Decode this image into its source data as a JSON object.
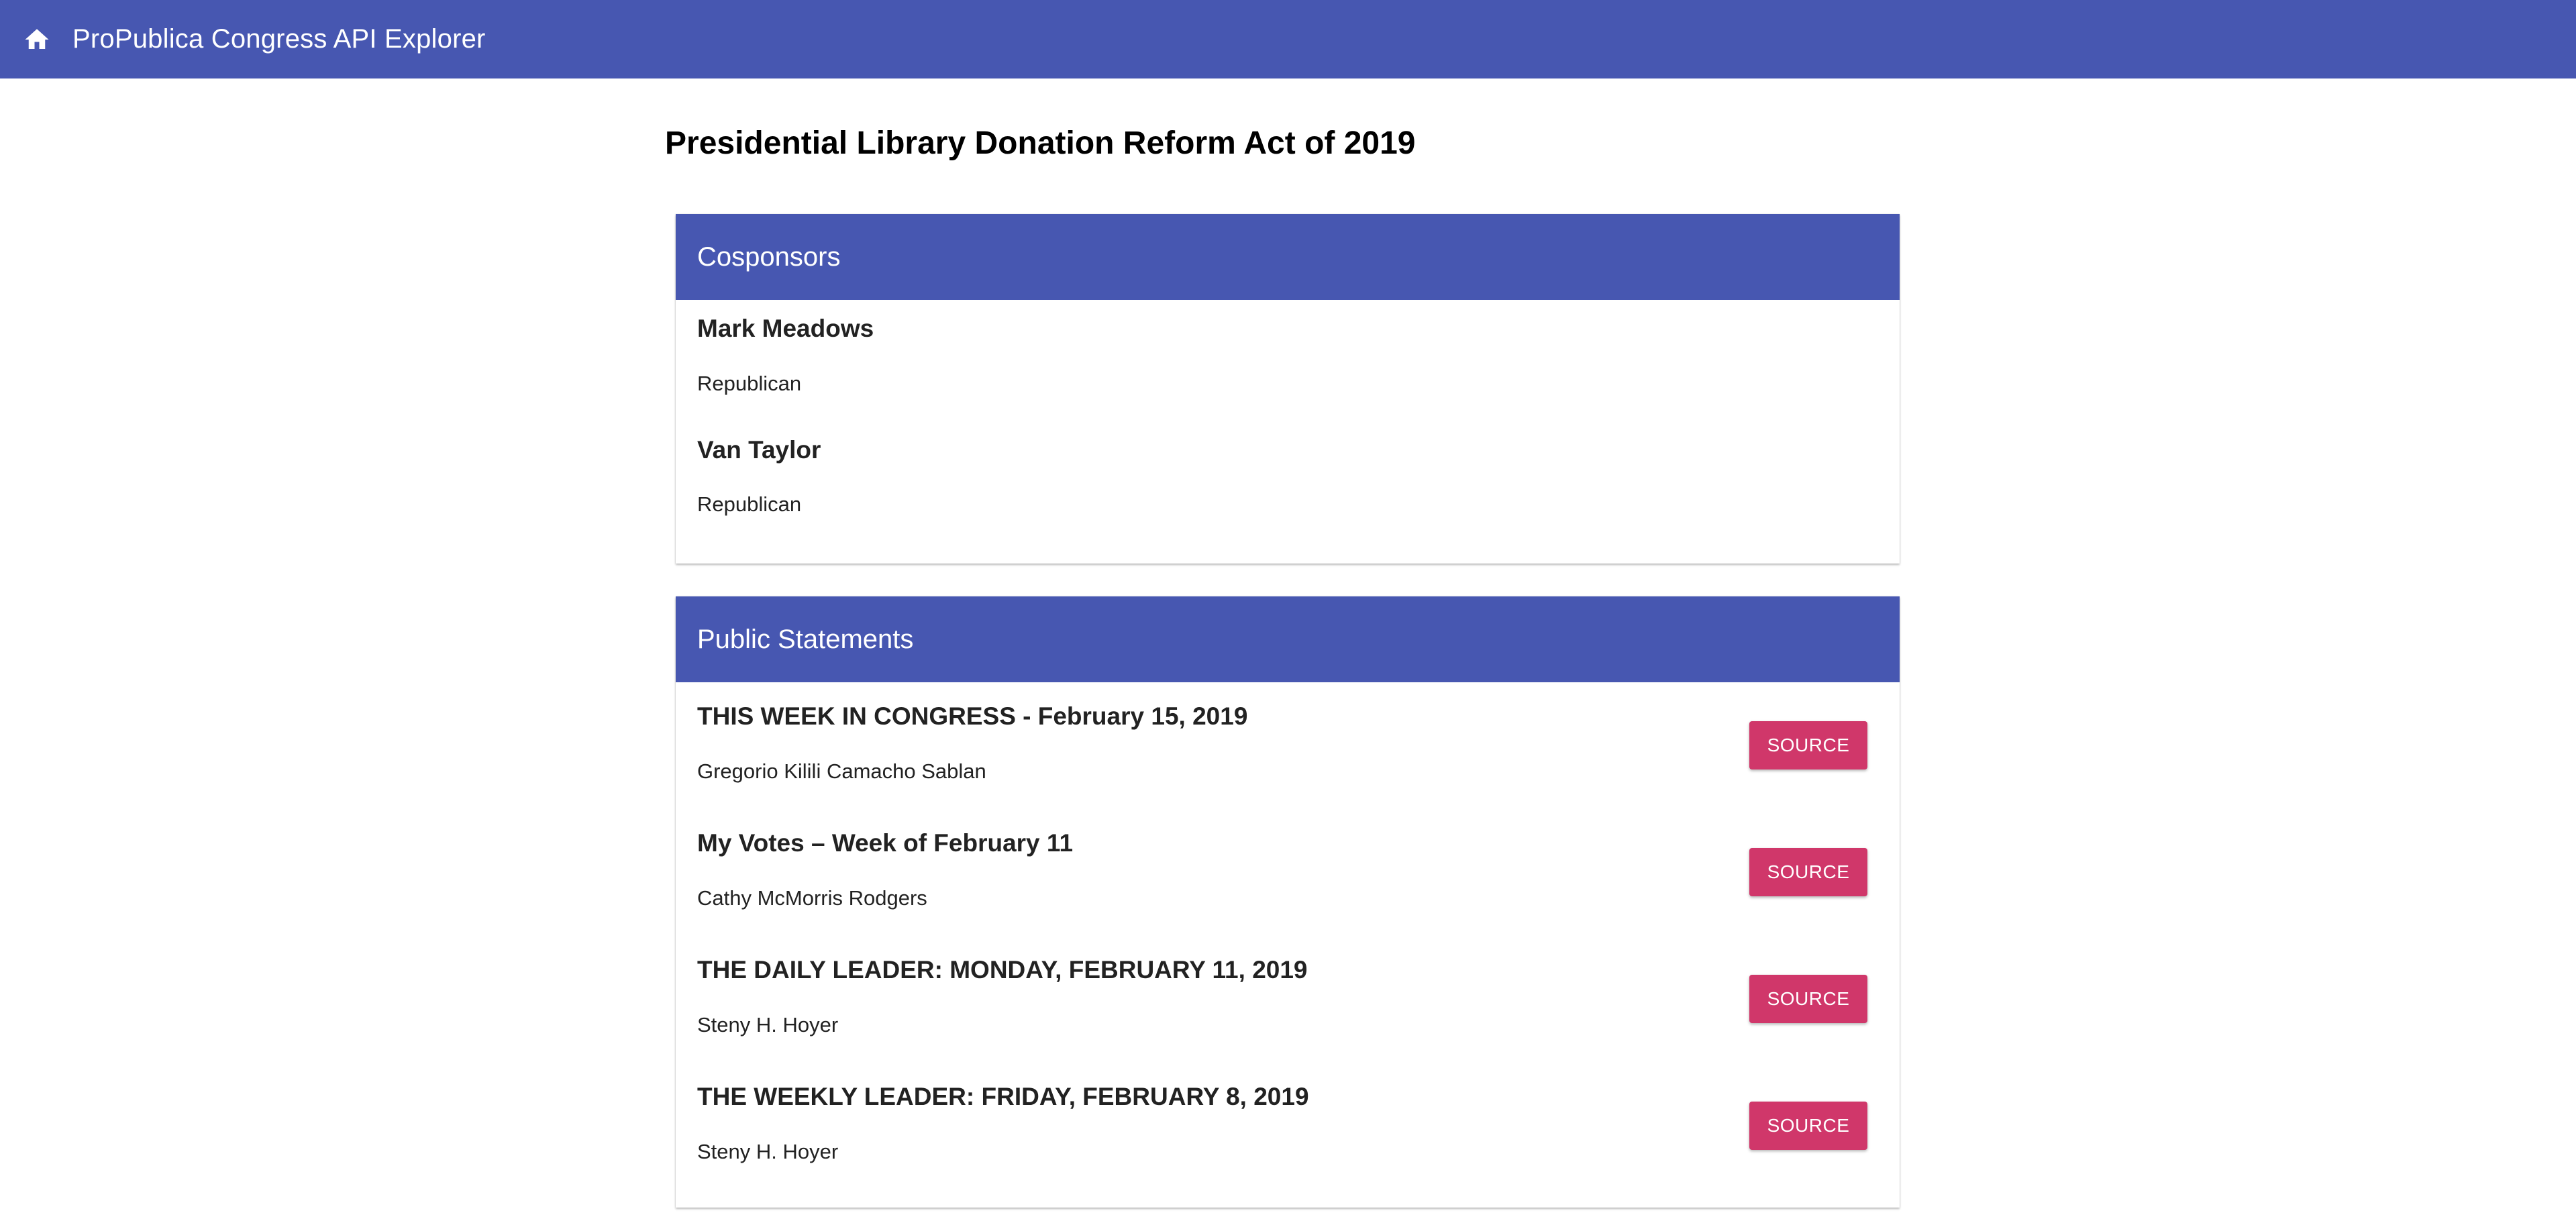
{
  "toolbar": {
    "icon": "home-icon",
    "title": "ProPublica Congress API Explorer",
    "color": "#4757b1"
  },
  "bill": {
    "title": "Presidential Library Donation Reform Act of 2019"
  },
  "cosponsors": {
    "header": "Cosponsors",
    "items": [
      {
        "name": "Mark Meadows",
        "party": "Republican"
      },
      {
        "name": "Van Taylor",
        "party": "Republican"
      }
    ]
  },
  "statements": {
    "header": "Public Statements",
    "button_label": "SOURCE",
    "button_color": "#d0376a",
    "items": [
      {
        "title": "THIS WEEK IN CONGRESS - February 15, 2019",
        "member": "Gregorio Kilili Camacho Sablan"
      },
      {
        "title": "My Votes – Week of February 11",
        "member": "Cathy McMorris Rodgers"
      },
      {
        "title": "THE DAILY LEADER: MONDAY, FEBRUARY 11, 2019",
        "member": "Steny H. Hoyer"
      },
      {
        "title": "THE WEEKLY LEADER: FRIDAY, FEBRUARY 8, 2019",
        "member": "Steny H. Hoyer"
      }
    ]
  }
}
